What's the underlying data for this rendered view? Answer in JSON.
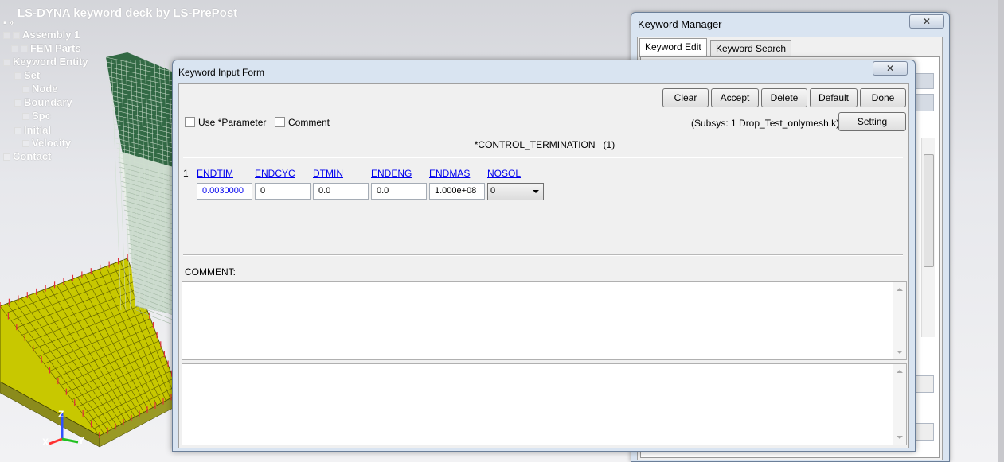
{
  "viewport": {
    "title": "LS-DYNA keyword deck by LS-PrePost",
    "tree": [
      {
        "label": "Assembly 1",
        "checkbox": true
      },
      {
        "label": "FEM Parts",
        "checkbox": true
      },
      {
        "label": "Keyword Entity",
        "checkbox": false
      },
      {
        "label": "Set",
        "checkbox": false
      },
      {
        "label": "Node",
        "checkbox": false
      },
      {
        "label": "Boundary",
        "checkbox": false
      },
      {
        "label": "Spc",
        "checkbox": false
      },
      {
        "label": "Initial",
        "checkbox": false
      },
      {
        "label": "Velocity",
        "checkbox": false
      },
      {
        "label": "Contact",
        "checkbox": false
      }
    ],
    "axes": {
      "z": "Z",
      "x": "X",
      "y": "Y"
    },
    "colors": {
      "plate": "#c8c800",
      "mesh_line": "#5a5a00",
      "part_green": "#2e6b3c",
      "node_mark": "#e0303a"
    }
  },
  "keyword_manager": {
    "title": "Keyword Manager",
    "close_glyph": "✕",
    "tabs": [
      "Keyword Edit",
      "Keyword Search"
    ],
    "active_tab": "Keyword Edit"
  },
  "keyword_input_form": {
    "title": "Keyword Input Form",
    "close_glyph": "✕",
    "buttons": {
      "clear": "Clear",
      "accept": "Accept",
      "delete": "Delete",
      "default": "Default",
      "done": "Done",
      "setting": "Setting"
    },
    "use_parameter_label": "Use *Parameter",
    "comment_checkbox_label": "Comment",
    "subsys": "(Subsys: 1 Drop_Test_onlymesh.k)",
    "keyword_title": "*CONTROL_TERMINATION   (1)",
    "card_number": "1",
    "fields": [
      {
        "label": "ENDTIM",
        "value": "0.0030000"
      },
      {
        "label": "ENDCYC",
        "value": "0"
      },
      {
        "label": "DTMIN",
        "value": "0.0"
      },
      {
        "label": "ENDENG",
        "value": "0.0"
      },
      {
        "label": "ENDMAS",
        "value": "1.000e+08"
      },
      {
        "label": "NOSOL",
        "value": "0"
      }
    ],
    "comment_label": "COMMENT:",
    "link_color": "#0000ee"
  }
}
